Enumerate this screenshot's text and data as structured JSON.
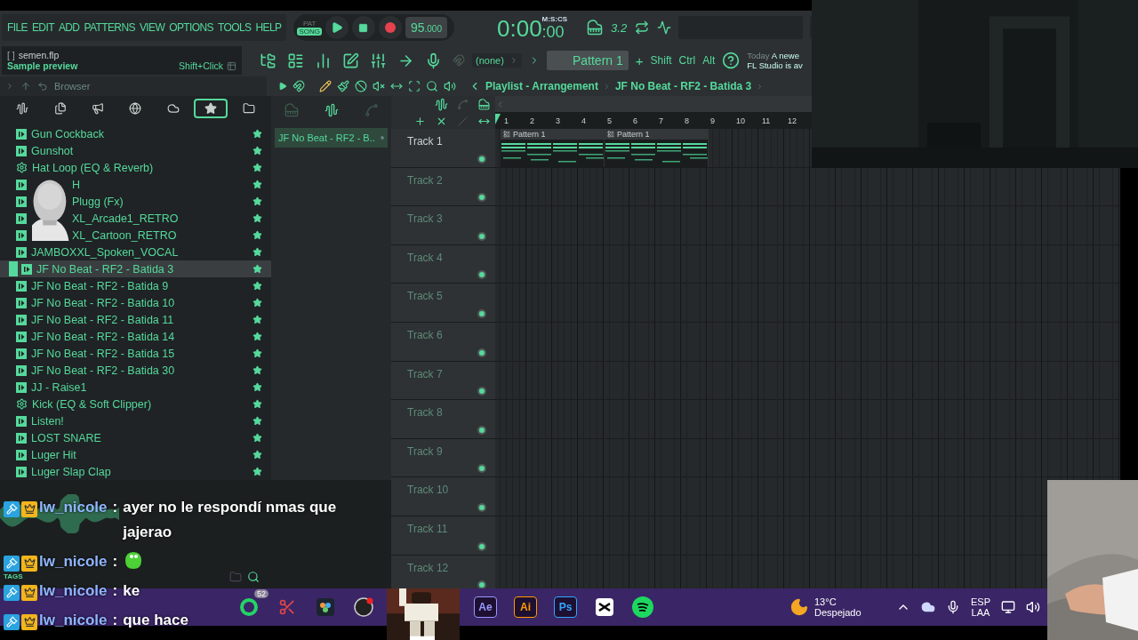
{
  "menu": [
    "FILE",
    "EDIT",
    "ADD",
    "PATTERNS",
    "VIEW",
    "OPTIONS",
    "TOOLS",
    "HELP"
  ],
  "transport": {
    "modes": [
      {
        "label": "PAT",
        "selected": false
      },
      {
        "label": "SONG",
        "selected": true
      }
    ],
    "tempo": "95",
    "tempo_decimals": ".000",
    "time": "0:00",
    "time_centis": ":00",
    "time_unit": "M:S:CS",
    "step": "3.2"
  },
  "hint": {
    "brackets": "[   ]",
    "file": "semen.flp",
    "title": "Sample preview",
    "shortcut": "Shift+Click"
  },
  "pattern_bar": {
    "channel": "(none)",
    "pattern": "Pattern 1",
    "plus": "+",
    "modifiers": [
      "Shift",
      "Ctrl",
      "Alt"
    ]
  },
  "news": {
    "date": "Today",
    "headline": "A newe",
    "body": "FL Studio is av"
  },
  "browser": {
    "title": "Browser",
    "tabs": [
      {
        "kind": "all",
        "selected": false
      },
      {
        "kind": "files",
        "selected": false
      },
      {
        "kind": "speaker",
        "selected": false
      },
      {
        "kind": "globe",
        "selected": false
      },
      {
        "kind": "cloud",
        "selected": false
      },
      {
        "kind": "starred",
        "selected": true
      },
      {
        "kind": "folder",
        "selected": false
      }
    ],
    "items": [
      {
        "name": "Gun Cockback",
        "kind": "sample",
        "selected": false,
        "covered": false
      },
      {
        "name": "Gunshot",
        "kind": "sample",
        "selected": false,
        "covered": false
      },
      {
        "name": "Hat Loop (EQ & Reverb)",
        "kind": "preset",
        "selected": false,
        "covered": false
      },
      {
        "name": "H",
        "kind": "sample",
        "selected": false,
        "covered": true
      },
      {
        "name": "Plugg (Fx)",
        "kind": "sample",
        "selected": false,
        "covered": true
      },
      {
        "name": "XL_Arcade1_RETRO",
        "kind": "sample",
        "selected": false,
        "covered": true
      },
      {
        "name": "XL_Cartoon_RETRO",
        "kind": "sample",
        "selected": false,
        "covered": true
      },
      {
        "name": "JAMBOXXL_Spoken_VOCAL",
        "kind": "sample",
        "selected": false,
        "covered": false
      },
      {
        "name": "JF No Beat - RF2 - Batida 3",
        "kind": "sample",
        "selected": true,
        "covered": false
      },
      {
        "name": "JF No Beat - RF2 - Batida 9",
        "kind": "sample",
        "selected": false,
        "covered": false
      },
      {
        "name": "JF No Beat - RF2 - Batida 10",
        "kind": "sample",
        "selected": false,
        "covered": false
      },
      {
        "name": "JF No Beat - RF2 - Batida 11",
        "kind": "sample",
        "selected": false,
        "covered": false
      },
      {
        "name": "JF No Beat - RF2 - Batida 14",
        "kind": "sample",
        "selected": false,
        "covered": false
      },
      {
        "name": "JF No Beat - RF2 - Batida 15",
        "kind": "sample",
        "selected": false,
        "covered": false
      },
      {
        "name": "JF No Beat - RF2 - Batida 30",
        "kind": "sample",
        "selected": false,
        "covered": false
      },
      {
        "name": "JJ - Raise1",
        "kind": "sample",
        "selected": false,
        "covered": false
      },
      {
        "name": "Kick (EQ & Soft Clipper)",
        "kind": "preset",
        "selected": false,
        "covered": false
      },
      {
        "name": "Listen!",
        "kind": "sample",
        "selected": false,
        "covered": false
      },
      {
        "name": "LOST SNARE",
        "kind": "sample",
        "selected": false,
        "covered": false
      },
      {
        "name": "Luger Hit",
        "kind": "sample",
        "selected": false,
        "covered": false
      },
      {
        "name": "Luger Slap Clap",
        "kind": "sample",
        "selected": false,
        "covered": false
      }
    ]
  },
  "picker": {
    "tabs": [
      {
        "kind": "piano",
        "selected": false
      },
      {
        "kind": "audio",
        "selected": true
      },
      {
        "kind": "automation",
        "selected": false
      }
    ],
    "item": "JF No Beat - RF2 - B.."
  },
  "playlist": {
    "breadcrumb": [
      "Playlist - Arrangement",
      "JF No Beat - RF2 - Batida 3"
    ],
    "bars": [
      "1",
      "2",
      "3",
      "4",
      "5",
      "6",
      "7",
      "8",
      "9",
      "10",
      "11",
      "12"
    ],
    "tracks": [
      {
        "name": "Track 1",
        "clips": [
          "Pattern 1",
          "Pattern 1"
        ]
      },
      {
        "name": "Track 2"
      },
      {
        "name": "Track 3"
      },
      {
        "name": "Track 4"
      },
      {
        "name": "Track 5"
      },
      {
        "name": "Track 6"
      },
      {
        "name": "Track 7"
      },
      {
        "name": "Track 8"
      },
      {
        "name": "Track 9"
      },
      {
        "name": "Track 10"
      },
      {
        "name": "Track 11"
      },
      {
        "name": "Track 12"
      }
    ]
  },
  "panel": {
    "tags": "TAGS"
  },
  "chat": [
    {
      "user": "lw_nicole",
      "separator": ":",
      "kind": "text",
      "message": "ayer no le respondí nmas que jajerao"
    },
    {
      "user": "lw_nicole",
      "separator": ":",
      "kind": "emote"
    },
    {
      "user": "lw_nicole",
      "separator": ":",
      "kind": "text",
      "message": "ke"
    },
    {
      "user": "lw_nicole",
      "separator": ":",
      "kind": "text",
      "message": "que hace"
    }
  ],
  "taskbar": {
    "apps": [
      {
        "kind": "whatsapp",
        "badge": "52"
      },
      {
        "kind": "snip"
      },
      {
        "kind": "davinci"
      },
      {
        "kind": "obs"
      },
      {
        "kind": "label",
        "label": "Ae",
        "color": "#9999ff"
      },
      {
        "kind": "label",
        "label": "Ai",
        "color": "#ff9a00"
      },
      {
        "kind": "label",
        "label": "Ps",
        "color": "#31a8ff"
      },
      {
        "kind": "capcut"
      },
      {
        "kind": "spotify"
      }
    ],
    "weather": {
      "temp": "13°C",
      "desc": "Despejado"
    },
    "language": [
      "ESP",
      "LAA"
    ]
  }
}
